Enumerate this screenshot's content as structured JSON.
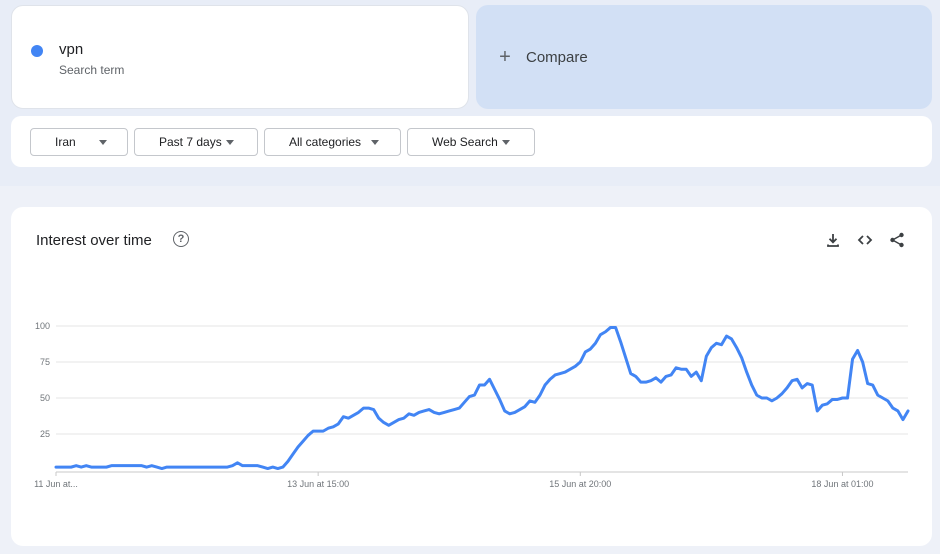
{
  "search_term": {
    "name": "vpn",
    "subtitle": "Search term",
    "color": "#4285f4"
  },
  "compare": {
    "label": "Compare",
    "icon": "plus-icon"
  },
  "filters": [
    {
      "label": "Iran"
    },
    {
      "label": "Past 7 days"
    },
    {
      "label": "All categories"
    },
    {
      "label": "Web Search"
    }
  ],
  "chart": {
    "title": "Interest over time",
    "icons": [
      "help-icon",
      "download-icon",
      "embed-code-icon",
      "share-icon"
    ]
  },
  "chart_data": {
    "type": "line",
    "title": "Interest over time",
    "xlabel": "",
    "ylabel": "",
    "ylim": [
      0,
      100
    ],
    "y_ticks": [
      25,
      50,
      75,
      100
    ],
    "grid": true,
    "x_tick_labels": [
      "11 Jun at...",
      "13 Jun at 15:00",
      "15 Jun at 20:00",
      "18 Jun at 01:00"
    ],
    "x_tick_positions": [
      0,
      52,
      104,
      156
    ],
    "line_color": "#4285f4",
    "series": [
      {
        "values": [
          2,
          2,
          2,
          2,
          3,
          2,
          3,
          2,
          2,
          2,
          2,
          3,
          3,
          3,
          3,
          3,
          3,
          3,
          2,
          3,
          2,
          1,
          2,
          2,
          2,
          2,
          2,
          2,
          2,
          2,
          2,
          2,
          2,
          2,
          2,
          3,
          5,
          3,
          3,
          3,
          3,
          2,
          1,
          2,
          1,
          2,
          6,
          11,
          16,
          20,
          24,
          27,
          27,
          27,
          29,
          30,
          32,
          37,
          36,
          38,
          40,
          43,
          43,
          42,
          36,
          33,
          31,
          33,
          35,
          36,
          39,
          38,
          40,
          41,
          42,
          40,
          39,
          40,
          41,
          42,
          43,
          47,
          51,
          52,
          59,
          59,
          63,
          56,
          49,
          41,
          39,
          40,
          42,
          44,
          48,
          47,
          52,
          59,
          63,
          66,
          67,
          68,
          70,
          72,
          75,
          82,
          84,
          88,
          94,
          96,
          99,
          99,
          89,
          78,
          67,
          65,
          61,
          61,
          62,
          64,
          61,
          65,
          66,
          71,
          70,
          70,
          65,
          68,
          62,
          79,
          85,
          88,
          87,
          93,
          91,
          85,
          78,
          68,
          59,
          52,
          50,
          50,
          48,
          50,
          53,
          57,
          62,
          63,
          57,
          60,
          59,
          41,
          45,
          46,
          49,
          49,
          50,
          50,
          77,
          83,
          75,
          60,
          59,
          52,
          50,
          48,
          43,
          41,
          35,
          41
        ]
      }
    ]
  }
}
